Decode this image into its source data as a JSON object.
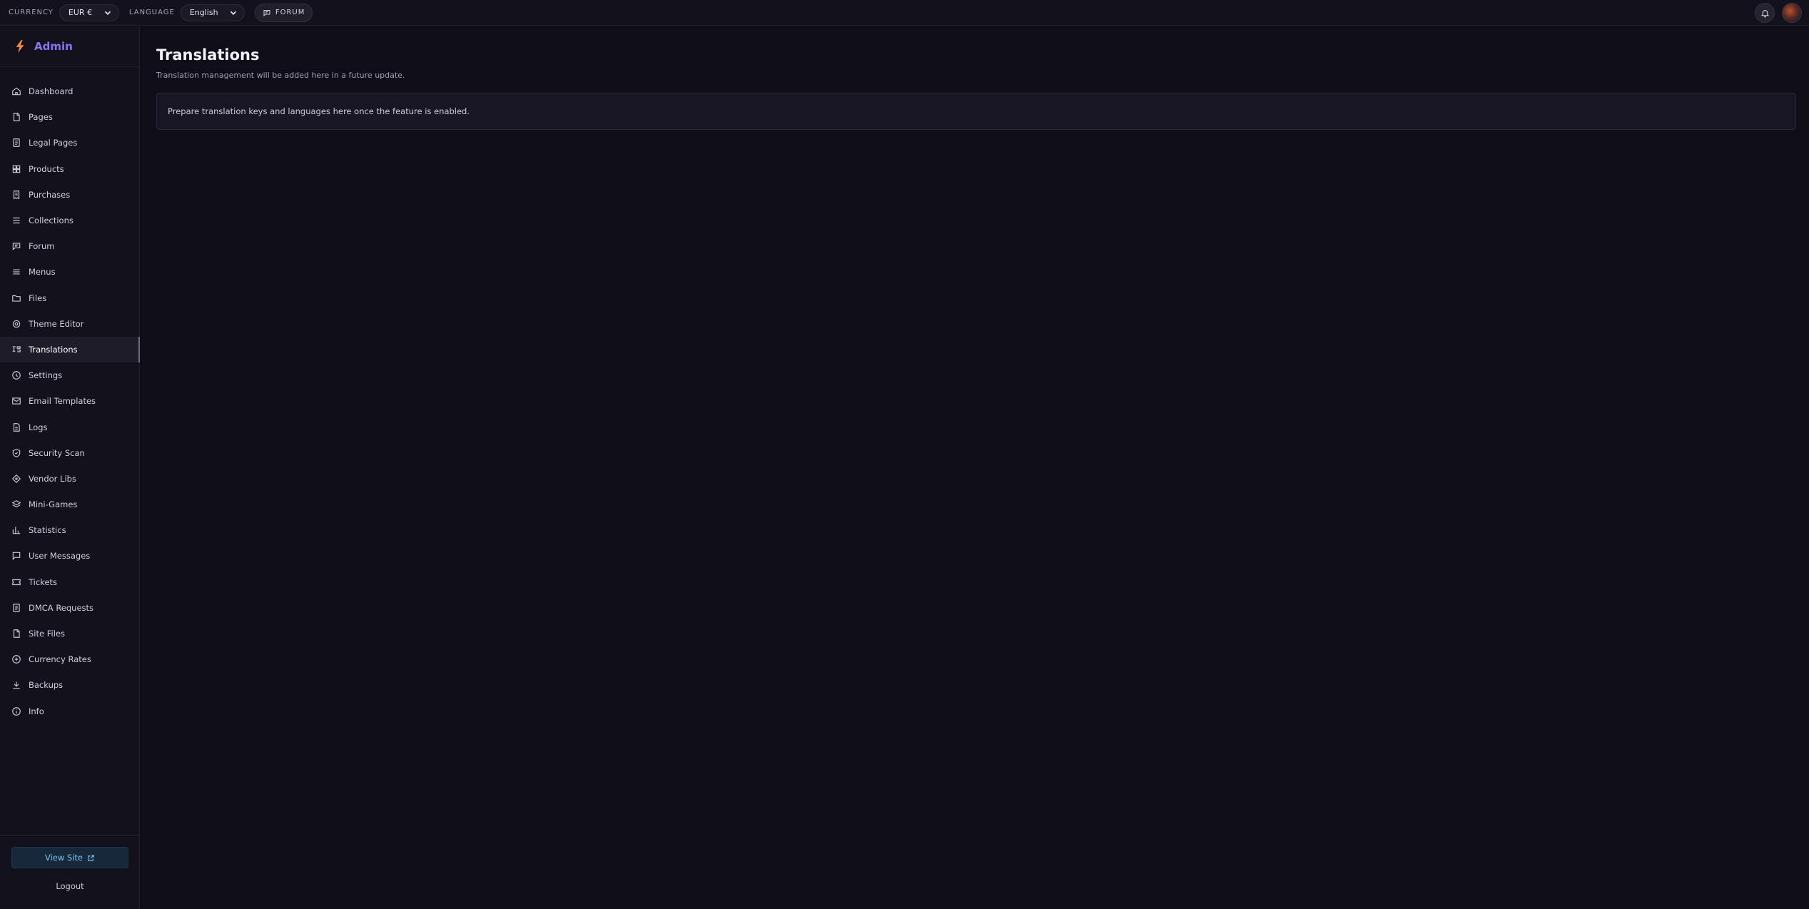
{
  "topbar": {
    "currency_label": "CURRENCY",
    "currency_value": "EUR €",
    "language_label": "LANGUAGE",
    "language_value": "English",
    "forum_label": "FORUM"
  },
  "brand": {
    "name": "Admin",
    "icon": "bolt-icon",
    "accent": "#8b73f0"
  },
  "sidebar": {
    "items": [
      {
        "label": "Dashboard",
        "icon": "home-icon"
      },
      {
        "label": "Pages",
        "icon": "file-icon"
      },
      {
        "label": "Legal Pages",
        "icon": "document-icon"
      },
      {
        "label": "Products",
        "icon": "grid-icon"
      },
      {
        "label": "Purchases",
        "icon": "receipt-icon"
      },
      {
        "label": "Collections",
        "icon": "list-icon"
      },
      {
        "label": "Forum",
        "icon": "chat-icon"
      },
      {
        "label": "Menus",
        "icon": "menu-icon"
      },
      {
        "label": "Files",
        "icon": "folder-icon"
      },
      {
        "label": "Theme Editor",
        "icon": "gear-icon"
      },
      {
        "label": "Translations",
        "icon": "translate-icon",
        "active": true
      },
      {
        "label": "Settings",
        "icon": "settings-icon"
      },
      {
        "label": "Email Templates",
        "icon": "mail-icon"
      },
      {
        "label": "Logs",
        "icon": "log-icon"
      },
      {
        "label": "Security Scan",
        "icon": "shield-icon"
      },
      {
        "label": "Vendor Libs",
        "icon": "diamond-icon"
      },
      {
        "label": "Mini-Games",
        "icon": "layers-icon"
      },
      {
        "label": "Statistics",
        "icon": "bar-chart-icon"
      },
      {
        "label": "User Messages",
        "icon": "message-icon"
      },
      {
        "label": "Tickets",
        "icon": "ticket-icon"
      },
      {
        "label": "DMCA Requests",
        "icon": "document-icon"
      },
      {
        "label": "Site Files",
        "icon": "file-icon"
      },
      {
        "label": "Currency Rates",
        "icon": "currency-icon"
      },
      {
        "label": "Backups",
        "icon": "download-icon"
      },
      {
        "label": "Info",
        "icon": "info-icon"
      }
    ],
    "view_site_label": "View Site",
    "logout_label": "Logout"
  },
  "main": {
    "title": "Translations",
    "subtitle": "Translation management will be added here in a future update.",
    "notice": "Prepare translation keys and languages here once the feature is enabled."
  }
}
